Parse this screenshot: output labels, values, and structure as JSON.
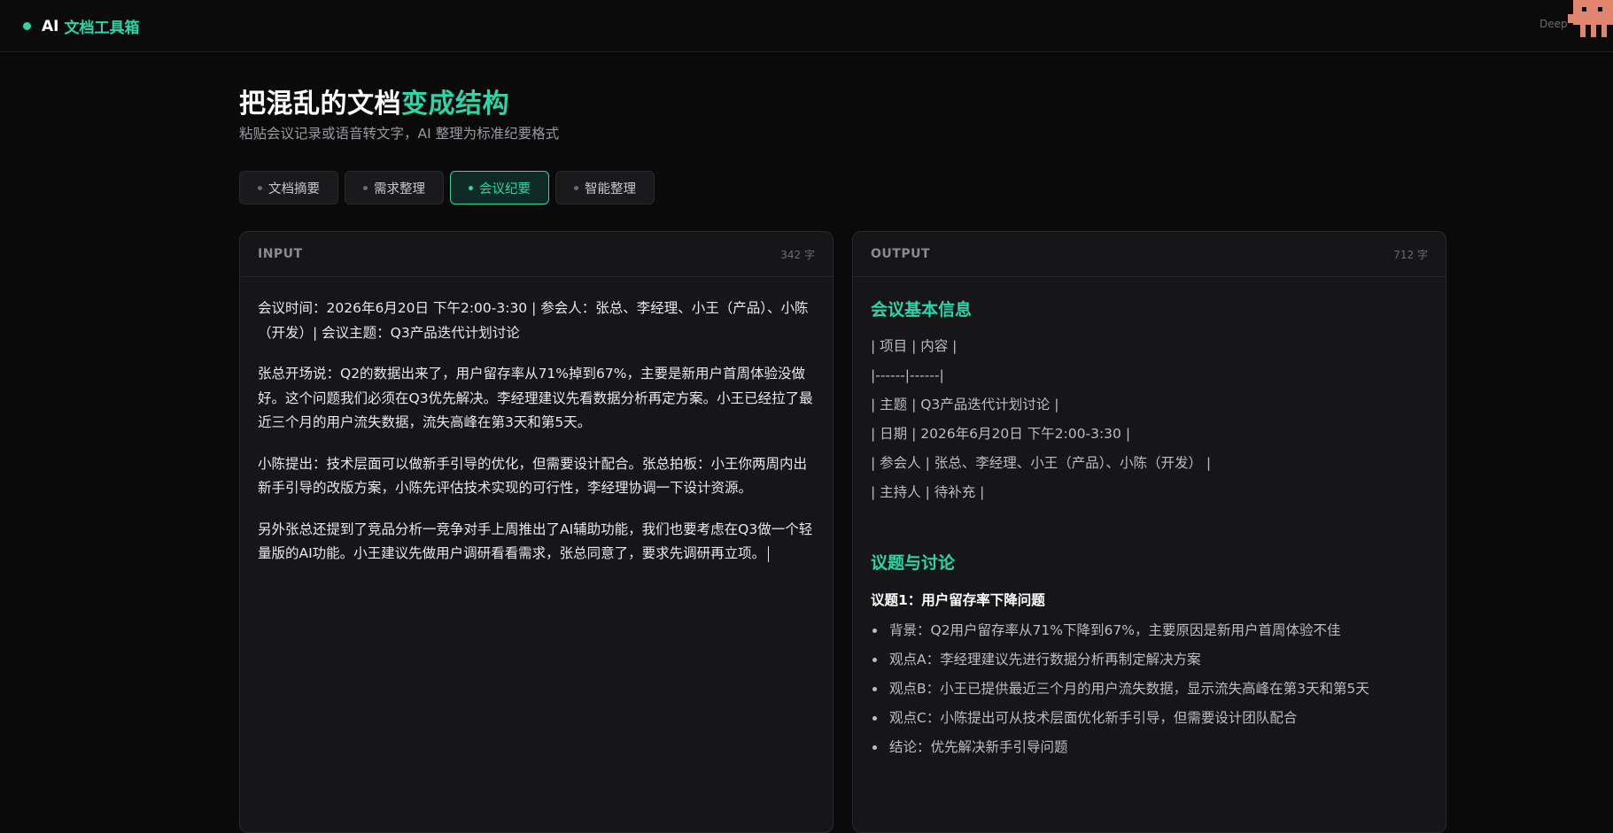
{
  "header": {
    "brand_ai": "AI",
    "brand_name": "文档工具箱",
    "right_text": "Deep"
  },
  "hero": {
    "title_main": "把混乱的文档",
    "title_highlight": "变成结构",
    "subtitle": "粘贴会议记录或语音转文字，AI 整理为标准纪要格式"
  },
  "tabs": [
    {
      "label": "文档摘要",
      "active": false
    },
    {
      "label": "需求整理",
      "active": false
    },
    {
      "label": "会议纪要",
      "active": true
    },
    {
      "label": "智能整理",
      "active": false
    }
  ],
  "input_panel": {
    "label": "INPUT",
    "count": "342 字",
    "paragraphs": [
      "会议时间：2026年6月20日 下午2:00-3:30 | 参会人：张总、李经理、小王（产品）、小陈（开发）| 会议主题：Q3产品迭代计划讨论",
      "张总开场说：Q2的数据出来了，用户留存率从71%掉到67%，主要是新用户首周体验没做好。这个问题我们必须在Q3优先解决。李经理建议先看数据分析再定方案。小王已经拉了最近三个月的用户流失数据，流失高峰在第3天和第5天。",
      "小陈提出：技术层面可以做新手引导的优化，但需要设计配合。张总拍板：小王你两周内出新手引导的改版方案，小陈先评估技术实现的可行性，李经理协调一下设计资源。",
      "另外张总还提到了竞品分析一竞争对手上周推出了AI辅助功能，我们也要考虑在Q3做一个轻量版的AI功能。小王建议先做用户调研看看需求，张总同意了，要求先调研再立项。"
    ]
  },
  "output_panel": {
    "label": "OUTPUT",
    "count": "712 字",
    "section1_title": "会议基本信息",
    "table_lines": [
      "| 项目 | 内容 |",
      "|------|------|",
      "| 主题 | Q3产品迭代计划讨论 |",
      "| 日期 | 2026年6月20日 下午2:00-3:30 |",
      "| 参会人 | 张总、李经理、小王（产品）、小陈（开发） |",
      "| 主持人 | 待补充 |"
    ],
    "section2_title": "议题与讨论",
    "issue1_title": "议题1：用户留存率下降问题",
    "bullets": [
      "背景：Q2用户留存率从71%下降到67%，主要原因是新用户首周体验不佳",
      "观点A：李经理建议先进行数据分析再制定解决方案",
      "观点B：小王已提供最近三个月的用户流失数据，显示流失高峰在第3天和第5天",
      "观点C：小陈提出可从技术层面优化新手引导，但需要设计团队配合",
      "结论：优先解决新手引导问题"
    ]
  },
  "colors": {
    "accent": "#2dd4a7",
    "background": "#0a0a0b",
    "panel": "#161618"
  }
}
